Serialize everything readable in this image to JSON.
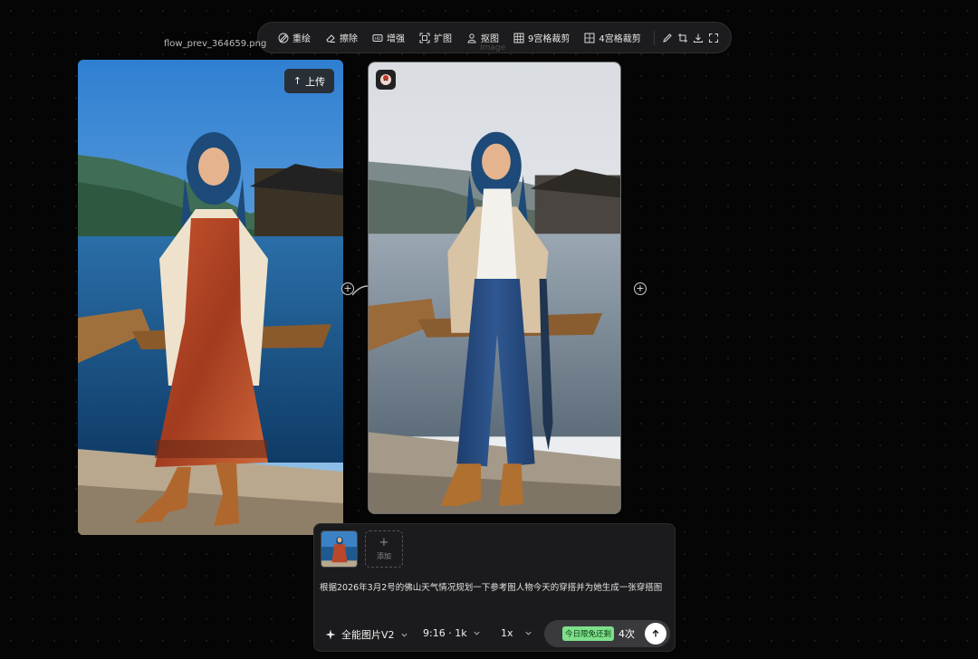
{
  "toolbar": {
    "items": [
      {
        "label": "重绘",
        "icon": "redraw-icon"
      },
      {
        "label": "擦除",
        "icon": "eraser-icon"
      },
      {
        "label": "增强",
        "icon": "hd-icon"
      },
      {
        "label": "扩图",
        "icon": "expand-icon"
      },
      {
        "label": "抠图",
        "icon": "cutout-icon"
      },
      {
        "label": "9宫格裁剪",
        "icon": "grid9-icon"
      },
      {
        "label": "4宫格裁剪",
        "icon": "grid4-icon"
      }
    ],
    "icon_actions": [
      "pencil-icon",
      "crop-icon",
      "download-icon",
      "fullscreen-icon"
    ]
  },
  "canvas": {
    "source_filename": "flow_prev_364659.png",
    "result_label": "Image",
    "upload_label": "上传",
    "upload_icon": "↑"
  },
  "prompt": {
    "add_label": "添加",
    "text": "根据2026年3月2号的佛山天气情况规划一下参考图人物今天的穿搭并为她生成一张穿搭图",
    "model": "全能图片V2",
    "aspect": "9:16 · 1k",
    "count": "1x",
    "free_badge": "今日限免还剩",
    "remaining": "4次"
  },
  "colors": {
    "background": "#050505",
    "panel": "#1b1b1d",
    "free_badge": "#7ee08a"
  }
}
